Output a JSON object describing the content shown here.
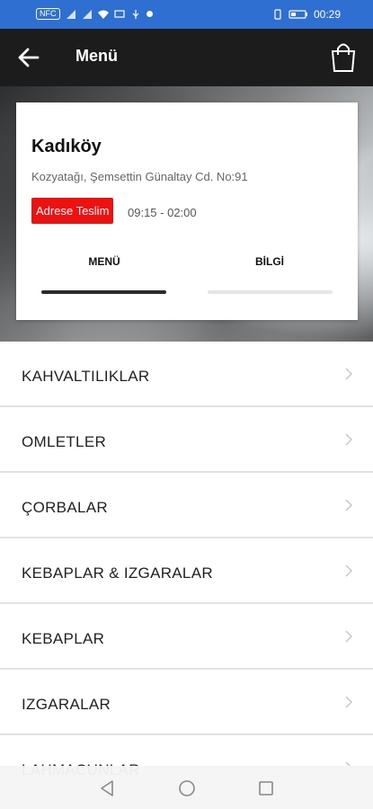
{
  "status_bar": {
    "nfc_label": "NFC",
    "time": "00:29"
  },
  "app_bar": {
    "title": "Menü",
    "back_icon": "arrow-left-icon",
    "cart_icon": "shopping-bag-icon"
  },
  "branch": {
    "name": "Kadıköy",
    "address": "Kozyatağı, Şemsettin Günaltay Cd. No:91",
    "delivery_badge": "Adrese Teslim",
    "hours": "09:15 - 02:00",
    "badge_color": "#ee1111"
  },
  "tabs": [
    {
      "label": "MENÜ",
      "selected": true
    },
    {
      "label": "BİLGİ",
      "selected": false
    }
  ],
  "categories": [
    {
      "label": "KAHVALTILIKLAR"
    },
    {
      "label": "OMLETLER"
    },
    {
      "label": "ÇORBALAR"
    },
    {
      "label": "KEBAPLAR & IZGARALAR"
    },
    {
      "label": "KEBAPLAR"
    },
    {
      "label": "IZGARALAR"
    },
    {
      "label": "LAHMACUNLAR"
    }
  ],
  "colors": {
    "status_bar": "#2f6fd2",
    "app_bar": "#1c1c1c"
  }
}
